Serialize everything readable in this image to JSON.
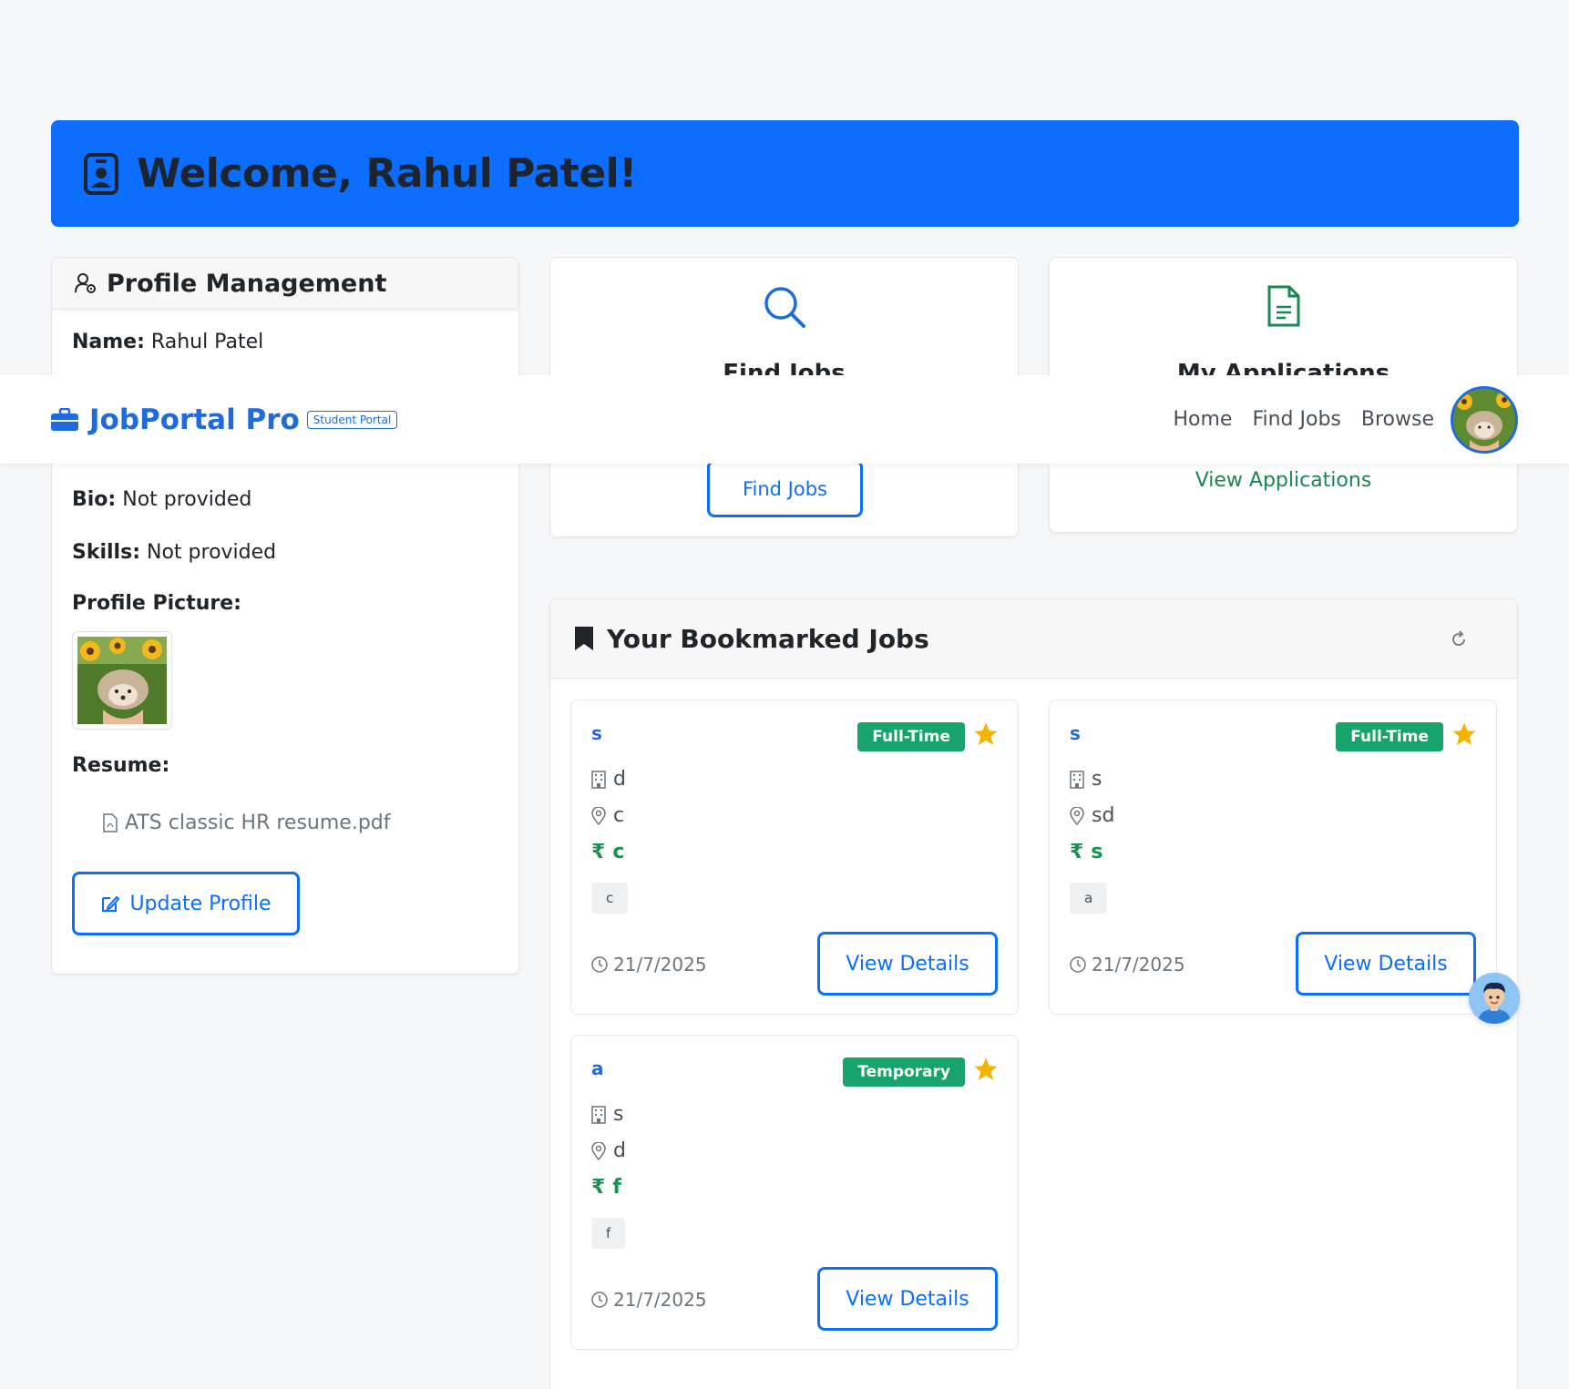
{
  "welcome": {
    "title": "Welcome, Rahul Patel!"
  },
  "navbar": {
    "brand": "JobPortal Pro",
    "badge": "Student Portal",
    "links": [
      "Home",
      "Find Jobs",
      "Browse"
    ]
  },
  "profile": {
    "header": "Profile Management",
    "name_label": "Name:",
    "name_value": "Rahul Patel",
    "bio_label": "Bio:",
    "bio_value": "Not provided",
    "skills_label": "Skills:",
    "skills_value": "Not provided",
    "picture_label": "Profile Picture:",
    "resume_label": "Resume:",
    "resume_file": "ATS classic HR resume.pdf",
    "update_button": "Update Profile"
  },
  "actions": {
    "find": {
      "title": "Find Jobs",
      "button": "Find Jobs"
    },
    "applications": {
      "title": "My Applications",
      "button": "View Applications"
    }
  },
  "bookmarks": {
    "header": "Your Bookmarked Jobs",
    "jobs": [
      {
        "title": "s",
        "type": "Full-Time",
        "company": "d",
        "location": "c",
        "salary": "c",
        "tag": "c",
        "date": "21/7/2025",
        "button": "View Details"
      },
      {
        "title": "s",
        "type": "Full-Time",
        "company": "s",
        "location": "sd",
        "salary": "s",
        "tag": "a",
        "date": "21/7/2025",
        "button": "View Details"
      },
      {
        "title": "a",
        "type": "Temporary",
        "company": "s",
        "location": "d",
        "salary": "f",
        "tag": "f",
        "date": "21/7/2025",
        "button": "View Details"
      }
    ]
  },
  "colors": {
    "primary": "#0d6efd",
    "brand": "#1f6bdc",
    "success": "#17a36b",
    "star": "#f5b301"
  },
  "icons": [
    "person-badge-icon",
    "person-gear-icon",
    "search-icon",
    "document-icon",
    "briefcase-icon",
    "bookmark-icon",
    "refresh-icon",
    "building-icon",
    "location-icon",
    "rupee-icon",
    "clock-icon",
    "star-icon",
    "pdf-file-icon",
    "edit-icon"
  ]
}
